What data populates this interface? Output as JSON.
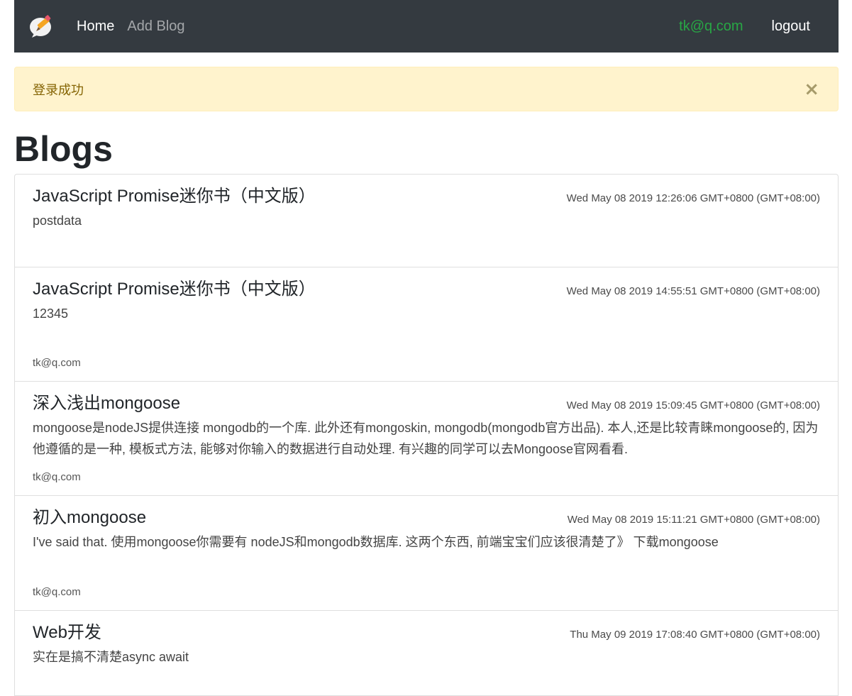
{
  "navbar": {
    "brand_icon": "chat-pencil-logo",
    "home_label": "Home",
    "add_blog_label": "Add Blog",
    "user_email": "tk@q.com",
    "logout_label": "logout"
  },
  "alert": {
    "message": "登录成功",
    "close_symbol": "×",
    "colors": {
      "background": "#fff3cd",
      "text": "#856404"
    }
  },
  "page": {
    "title": "Blogs"
  },
  "blogs": [
    {
      "title": "JavaScript Promise迷你书（中文版）",
      "date": "Wed May 08 2019 12:26:06 GMT+0800 (GMT+08:00)",
      "body": "postdata",
      "author": ""
    },
    {
      "title": "JavaScript Promise迷你书（中文版）",
      "date": "Wed May 08 2019 14:55:51 GMT+0800 (GMT+08:00)",
      "body": "12345",
      "author": "tk@q.com"
    },
    {
      "title": "深入浅出mongoose",
      "date": "Wed May 08 2019 15:09:45 GMT+0800 (GMT+08:00)",
      "body": "mongoose是nodeJS提供连接 mongodb的一个库. 此外还有mongoskin, mongodb(mongodb官方出品). 本人,还是比较青睐mongoose的, 因为他遵循的是一种, 模板式方法, 能够对你输入的数据进行自动处理. 有兴趣的同学可以去Mongoose官网看看.",
      "author": "tk@q.com"
    },
    {
      "title": "初入mongoose",
      "date": "Wed May 08 2019 15:11:21 GMT+0800 (GMT+08:00)",
      "body": "I've said that. 使用mongoose你需要有 nodeJS和mongodb数据库. 这两个东西, 前端宝宝们应该很清楚了》 下载mongoose",
      "author": "tk@q.com"
    },
    {
      "title": "Web开发",
      "date": "Thu May 09 2019 17:08:40 GMT+0800 (GMT+08:00)",
      "body": "实在是搞不清楚async await",
      "author": ""
    }
  ]
}
